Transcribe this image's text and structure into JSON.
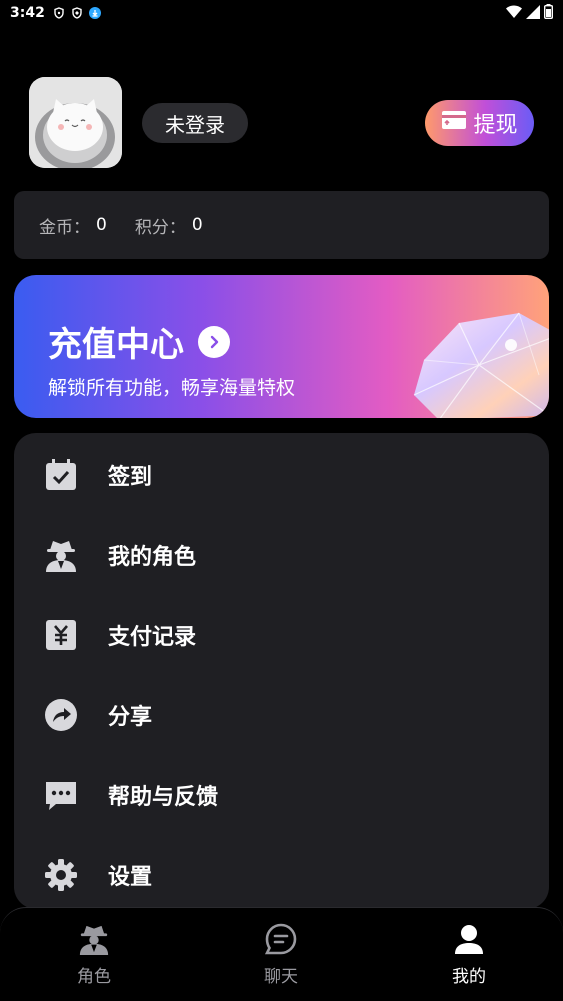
{
  "status_bar": {
    "time": "3:42"
  },
  "profile": {
    "login_label": "未登录",
    "withdraw_label": "提现"
  },
  "coins": {
    "gold_label": "金币：",
    "gold_value": "0",
    "points_label": "积分：",
    "points_value": "0"
  },
  "recharge": {
    "title": "充值中心",
    "subtitle": "解锁所有功能，畅享海量特权"
  },
  "menu": {
    "items": [
      {
        "label": "签到",
        "icon": "calendar-check-icon"
      },
      {
        "label": "我的角色",
        "icon": "spy-icon"
      },
      {
        "label": "支付记录",
        "icon": "receipt-yen-icon"
      },
      {
        "label": "分享",
        "icon": "share-icon"
      },
      {
        "label": "帮助与反馈",
        "icon": "chat-dots-icon"
      },
      {
        "label": "设置",
        "icon": "gear-icon"
      }
    ]
  },
  "bottom_nav": {
    "items": [
      {
        "label": "角色",
        "icon": "spy-icon",
        "active": false
      },
      {
        "label": "聊天",
        "icon": "chat-icon",
        "active": false
      },
      {
        "label": "我的",
        "icon": "user-icon",
        "active": true
      }
    ]
  },
  "colors": {
    "background": "#000000",
    "card": "#1f1f23",
    "inactive_text": "#9a9aa0"
  }
}
